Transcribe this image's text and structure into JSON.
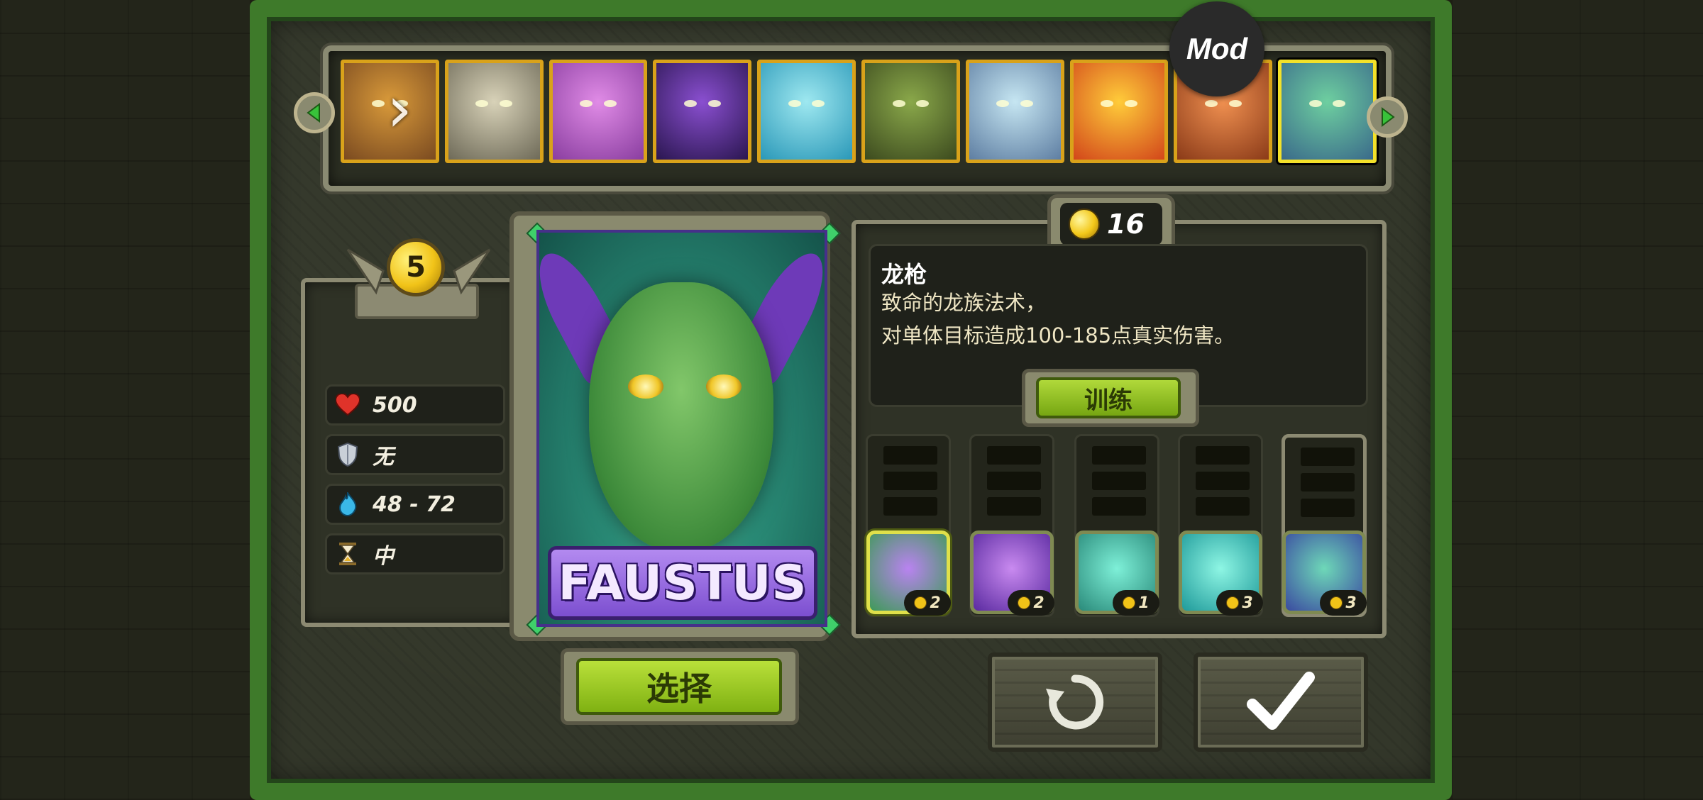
{
  "mod_badge": "Mod",
  "hero_strip": {
    "portraits": [
      {
        "name": "hero-portrait-1",
        "colors": [
          "#d99a3a",
          "#7a4a20"
        ]
      },
      {
        "name": "hero-portrait-2",
        "colors": [
          "#d8d2b8",
          "#6e6a58"
        ]
      },
      {
        "name": "hero-portrait-3",
        "colors": [
          "#e08be6",
          "#8a3ea0"
        ]
      },
      {
        "name": "hero-portrait-4",
        "colors": [
          "#8a4fd0",
          "#2a1650"
        ]
      },
      {
        "name": "hero-portrait-5",
        "colors": [
          "#9ee8f0",
          "#2a98b8"
        ]
      },
      {
        "name": "hero-portrait-6",
        "colors": [
          "#8aa84a",
          "#3c4a1e"
        ]
      },
      {
        "name": "hero-portrait-7",
        "colors": [
          "#c6e6f2",
          "#5e7ea2"
        ]
      },
      {
        "name": "hero-portrait-8",
        "colors": [
          "#ffcc3a",
          "#d2461a"
        ]
      },
      {
        "name": "hero-portrait-9",
        "colors": [
          "#f09050",
          "#8a3a18"
        ]
      },
      {
        "name": "hero-portrait-10",
        "colors": [
          "#6ecfa0",
          "#3a6a8a"
        ]
      }
    ],
    "selected_index": 9
  },
  "hero": {
    "level": "5",
    "name": "FAUSTUS",
    "select_label": "选择"
  },
  "stats": {
    "health": "500",
    "armor": "无",
    "damage": "48 - 72",
    "speed": "中"
  },
  "skill_points": "16",
  "skill": {
    "title": "龙枪",
    "line1": "致命的龙族法术，",
    "line2": "对单体目标造成100-185点真实伤害。",
    "train_label": "训练"
  },
  "skills": [
    {
      "name": "skill-dragon-lance",
      "cost": "2",
      "colors": [
        "#b983f0",
        "#3e9a58"
      ]
    },
    {
      "name": "skill-spiral",
      "cost": "2",
      "colors": [
        "#c98af0",
        "#5a2aa0"
      ]
    },
    {
      "name": "skill-totem",
      "cost": "1",
      "colors": [
        "#7ef0d8",
        "#2a8a7a"
      ]
    },
    {
      "name": "skill-mist",
      "cost": "3",
      "colors": [
        "#8ef6e4",
        "#1f9a9a"
      ]
    },
    {
      "name": "skill-summon",
      "cost": "3",
      "colors": [
        "#6ed8b8",
        "#3a4aa0"
      ]
    }
  ],
  "accent": {
    "gold": "#f1c318",
    "green_button": "#9fcb24",
    "vine": "#3e7a2a"
  }
}
